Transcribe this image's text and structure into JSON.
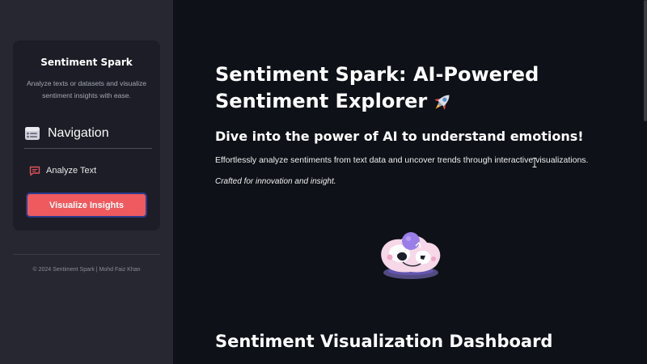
{
  "sidebar": {
    "brand_title": "Sentiment Spark",
    "brand_description": "Analyze texts or datasets and visualize sentiment insights with ease.",
    "nav_title": "Navigation",
    "nav_icon": "menu-list-icon",
    "items": [
      {
        "label": "Analyze Text",
        "icon": "chat-bubble-icon",
        "active": false
      },
      {
        "label": "Visualize Insights",
        "active": true
      }
    ],
    "footer": "© 2024 Sentiment Spark | Mohd Faiz Khan"
  },
  "main": {
    "title": "Sentiment Spark: AI-Powered Sentiment Explorer",
    "title_icon": "rocket-icon",
    "subtitle": "Dive into the power of AI to understand emotions!",
    "intro": "Effortlessly analyze sentiments from text data and uncover trends through interactive visualizations.",
    "tagline": "Crafted for innovation and insight.",
    "section_heading": "Sentiment Visualization Dashboard"
  },
  "colors": {
    "background": "#0e1117",
    "sidebar": "#262730",
    "sidebar_card": "#1c1d26",
    "accent": "#ee5a5e",
    "button_border": "#2d3b8c"
  }
}
